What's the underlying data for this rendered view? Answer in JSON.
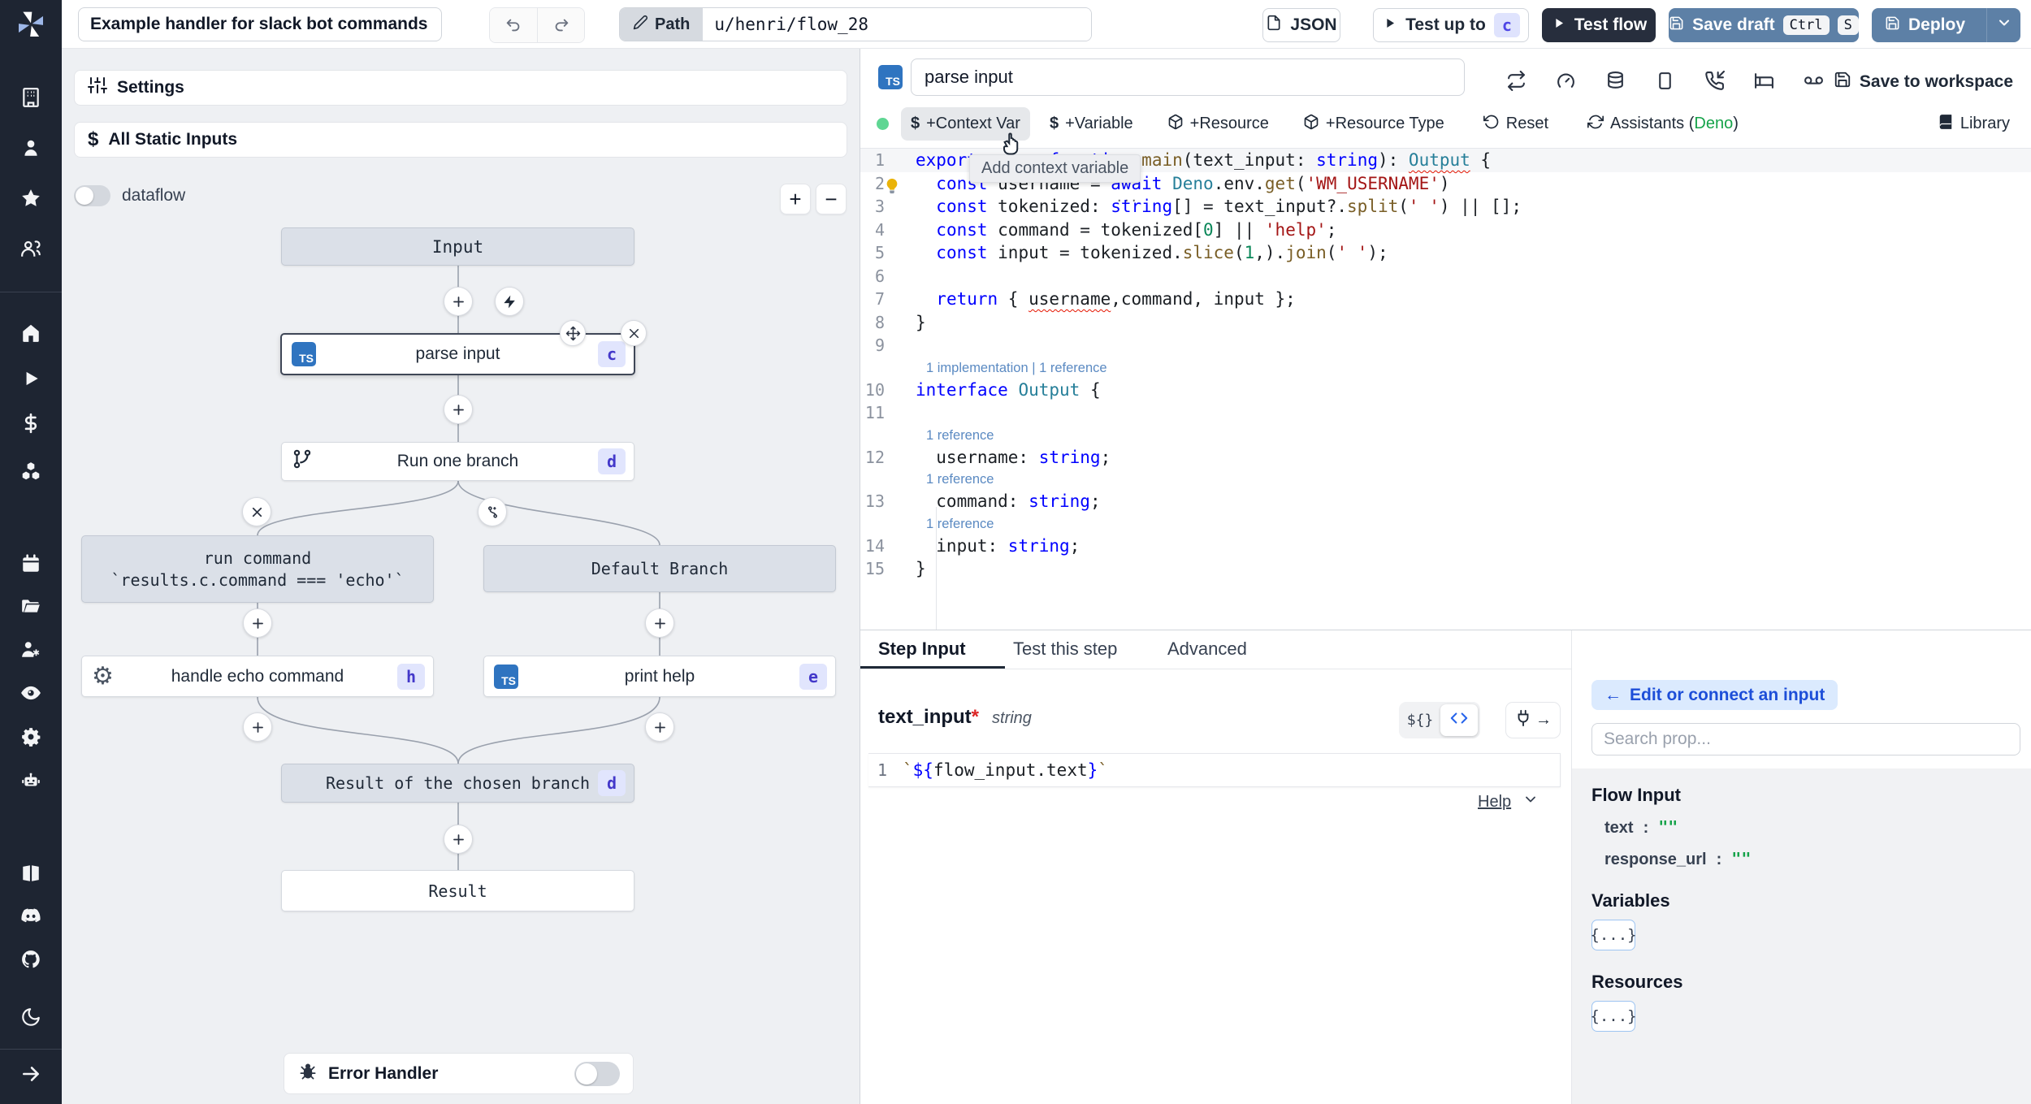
{
  "topbar": {
    "title_value": "Example handler for slack bot commands",
    "path_label": "Path",
    "path_value": "u/henri/flow_28",
    "json_label": "JSON",
    "test_up_to_label": "Test up to",
    "test_up_to_badge": "c",
    "test_flow_label": "Test flow",
    "save_draft_label": "Save draft",
    "kbd_ctrl": "Ctrl",
    "kbd_s": "S",
    "deploy_label": "Deploy"
  },
  "sidebar": {
    "icons": [
      "building",
      "user",
      "star",
      "users",
      "home",
      "play",
      "dollar",
      "cubes",
      "calendar",
      "folder",
      "user-cog",
      "eye",
      "gear",
      "robot",
      "book",
      "discord",
      "github",
      "moon",
      "arrow-right"
    ]
  },
  "flow": {
    "settings_label": "Settings",
    "static_inputs_label": "All Static Inputs",
    "dataflow_label": "dataflow",
    "error_handler_label": "Error Handler",
    "nodes": {
      "input": {
        "label": "Input"
      },
      "parse_input": {
        "label": "parse input",
        "badge": "c",
        "lang": "TS"
      },
      "run_one_branch": {
        "label": "Run one branch",
        "badge": "d"
      },
      "run_command": {
        "label": "run command",
        "condition": "`results.c.command === 'echo'`"
      },
      "default_branch": {
        "label": "Default Branch"
      },
      "handle_echo": {
        "label": "handle echo command",
        "badge": "h"
      },
      "print_help": {
        "label": "print help",
        "badge": "e",
        "lang": "TS"
      },
      "result_branch": {
        "label": "Result of the chosen branch",
        "badge": "d"
      },
      "result": {
        "label": "Result"
      }
    }
  },
  "editor": {
    "lang_badge": "TS",
    "step_name": "parse input",
    "save_to_workspace_label": "Save to workspace",
    "toolbar": {
      "context_var": "+Context Var",
      "variable": "+Variable",
      "resource": "+Resource",
      "resource_type": "+Resource Type",
      "reset": "Reset",
      "assistants_prefix": "Assistants (",
      "assistants_lang": "Deno",
      "assistants_suffix": ")",
      "library": "Library",
      "dollar": "$"
    },
    "tooltip": "Add context variable",
    "code": {
      "lines": [
        {
          "n": "1",
          "hl": true,
          "tokens": [
            [
              "export ",
              "kw"
            ],
            [
              "async ",
              "kw"
            ],
            [
              "function ",
              "kw"
            ],
            [
              "main",
              "fn"
            ],
            [
              "(text_input: ",
              "pl"
            ],
            [
              "string",
              "kw"
            ],
            [
              "): ",
              "pl"
            ],
            [
              "Output",
              "typ",
              "sq"
            ],
            [
              " {",
              "pl"
            ]
          ]
        },
        {
          "n": "2",
          "tokens": [
            [
              "  ",
              "pl"
            ],
            [
              "const ",
              "kw"
            ],
            [
              "username = ",
              "pl"
            ],
            [
              "await",
              "kw",
              "dots"
            ],
            [
              " ",
              "pl"
            ],
            [
              "Deno",
              "typ"
            ],
            [
              ".env.",
              "pl"
            ],
            [
              "get",
              "fn"
            ],
            [
              "(",
              "pl"
            ],
            [
              "'WM_USERNAME'",
              "str"
            ],
            [
              ")",
              "pl"
            ]
          ]
        },
        {
          "n": "3",
          "tokens": [
            [
              "  ",
              "pl"
            ],
            [
              "const ",
              "kw"
            ],
            [
              "tokenized: ",
              "pl"
            ],
            [
              "string",
              "kw"
            ],
            [
              "[] = text_input?.",
              "pl"
            ],
            [
              "split",
              "fn"
            ],
            [
              "(",
              "pl"
            ],
            [
              "' '",
              "str"
            ],
            [
              ") || [];",
              "pl"
            ]
          ]
        },
        {
          "n": "4",
          "tokens": [
            [
              "  ",
              "pl"
            ],
            [
              "const ",
              "kw"
            ],
            [
              "command = tokenized[",
              "pl"
            ],
            [
              "0",
              "num"
            ],
            [
              "] || ",
              "pl"
            ],
            [
              "'help'",
              "str"
            ],
            [
              ";",
              "pl"
            ]
          ]
        },
        {
          "n": "5",
          "tokens": [
            [
              "  ",
              "pl"
            ],
            [
              "const ",
              "kw"
            ],
            [
              "input = tokenized.",
              "pl"
            ],
            [
              "slice",
              "fn"
            ],
            [
              "(",
              "pl"
            ],
            [
              "1",
              "num"
            ],
            [
              ",).",
              "pl"
            ],
            [
              "join",
              "fn"
            ],
            [
              "(",
              "pl"
            ],
            [
              "' '",
              "str"
            ],
            [
              ");",
              "pl"
            ]
          ]
        },
        {
          "n": "6",
          "tokens": []
        },
        {
          "n": "7",
          "tokens": [
            [
              "  ",
              "pl"
            ],
            [
              "return",
              "kw"
            ],
            [
              " { ",
              "pl"
            ],
            [
              "username",
              "pl",
              "sq"
            ],
            [
              ",command, input };",
              "pl"
            ]
          ]
        },
        {
          "n": "8",
          "tokens": [
            [
              "}",
              "pl"
            ]
          ]
        },
        {
          "n": "9",
          "tokens": []
        },
        {
          "n": "10",
          "lens": "1 implementation | 1 reference",
          "tokens": [
            [
              "interface ",
              "kw"
            ],
            [
              "Output",
              "typ"
            ],
            [
              " {",
              "pl"
            ]
          ]
        },
        {
          "n": "11",
          "tokens": []
        },
        {
          "n": "12",
          "lens": "1 reference",
          "tokens": [
            [
              "  username: ",
              "pl"
            ],
            [
              "string",
              "kw"
            ],
            [
              ";",
              "pl"
            ]
          ]
        },
        {
          "n": "13",
          "lens": "1 reference",
          "tokens": [
            [
              "  command: ",
              "pl"
            ],
            [
              "string",
              "kw"
            ],
            [
              ";",
              "pl"
            ]
          ]
        },
        {
          "n": "14",
          "lens": "1 reference",
          "tokens": [
            [
              "  input: ",
              "pl"
            ],
            [
              "string",
              "kw"
            ],
            [
              ";",
              "pl"
            ]
          ]
        },
        {
          "n": "15",
          "tokens": [
            [
              "}",
              "pl"
            ]
          ]
        }
      ]
    }
  },
  "bottom": {
    "tabs": [
      "Step Input",
      "Test this step",
      "Advanced"
    ],
    "field": {
      "name": "text_input",
      "required": "*",
      "type": "string"
    },
    "expr_line_number": "1",
    "expr_tokens": [
      [
        "`",
        "tk2"
      ],
      [
        "${",
        "br"
      ],
      [
        "flow_input.text",
        "pl"
      ],
      [
        "}",
        "br"
      ],
      [
        "`",
        "tk2"
      ]
    ],
    "toggle_template": "${}",
    "help_label": "Help"
  },
  "connect": {
    "back_label": "Edit or connect an input",
    "search_placeholder": "Search prop...",
    "flow_input_header": "Flow Input",
    "props": [
      {
        "key": "text",
        "colon": ":",
        "value": "\"\""
      },
      {
        "key": "response_url",
        "colon": ":",
        "value": "\"\""
      }
    ],
    "variables_header": "Variables",
    "resources_header": "Resources",
    "object_chip": "{...}"
  }
}
